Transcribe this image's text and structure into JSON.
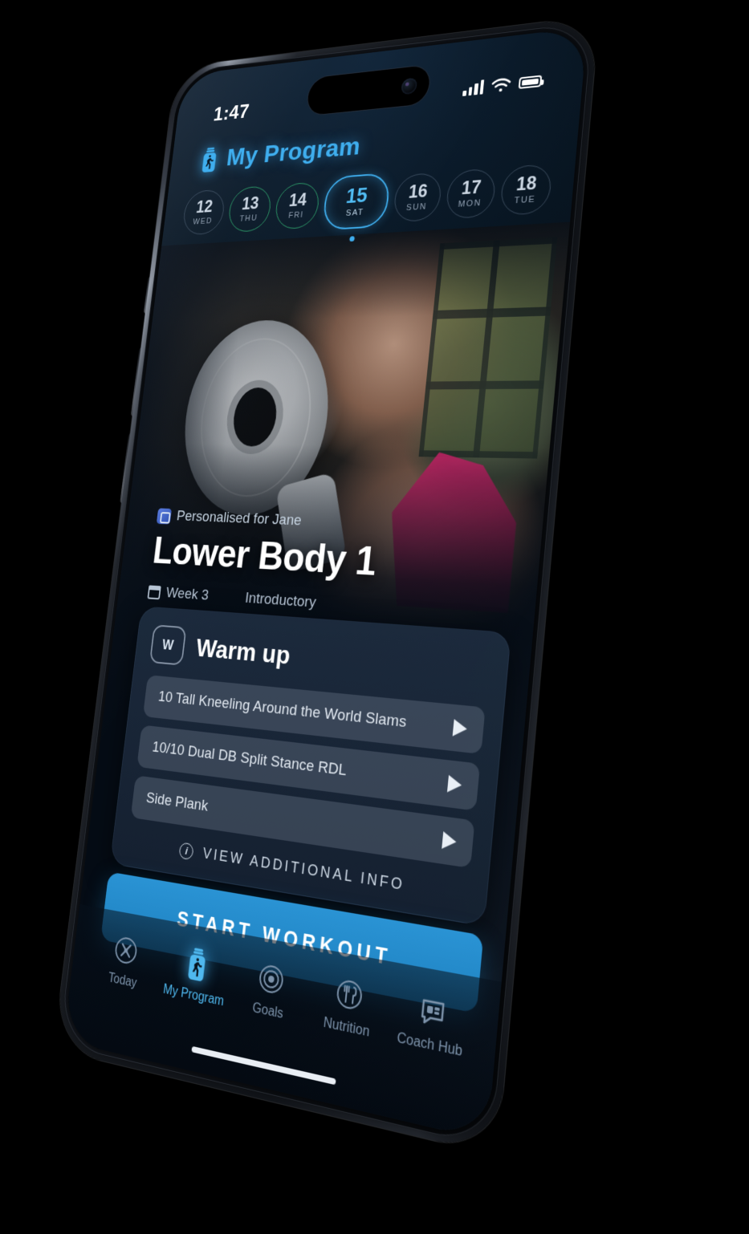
{
  "status_bar": {
    "time": "1:47",
    "icons": [
      "signal-bars-icon",
      "wifi-icon",
      "battery-icon"
    ]
  },
  "header": {
    "title": "My Program",
    "icon": "program-bottle-icon",
    "accent_color": "#3FAEEE"
  },
  "date_strip": {
    "days": [
      {
        "num": "12",
        "weekday": "WED",
        "state": "past"
      },
      {
        "num": "13",
        "weekday": "THU",
        "state": "completed"
      },
      {
        "num": "14",
        "weekday": "FRI",
        "state": "completed"
      },
      {
        "num": "15",
        "weekday": "SAT",
        "state": "selected"
      },
      {
        "num": "16",
        "weekday": "SUN",
        "state": "future"
      },
      {
        "num": "17",
        "weekday": "MON",
        "state": "future"
      },
      {
        "num": "18",
        "weekday": "TUE",
        "state": "future"
      }
    ],
    "completed_color": "#2E9E6B",
    "selected_color": "#3FAEEE"
  },
  "workout": {
    "personalised_label": "Personalised for Jane",
    "personalised_icon": "personalised-badge-icon",
    "title": "Lower Body 1",
    "week_label": "Week 3",
    "week_icon": "calendar-icon",
    "level_label": "Introductory"
  },
  "warmup_card": {
    "badge": "W",
    "title": "Warm up",
    "exercises": [
      {
        "name": "10 Tall Kneeling Around the World Slams"
      },
      {
        "name": "10/10 Dual DB Split Stance RDL"
      },
      {
        "name": "Side Plank"
      }
    ],
    "info_link": "VIEW ADDITIONAL INFO",
    "info_icon": "info-circle-icon"
  },
  "primary_action": {
    "label": "START WORKOUT",
    "color": "#2A93D4"
  },
  "tab_bar": {
    "items": [
      {
        "label": "Today",
        "icon": "today-icon",
        "active": false
      },
      {
        "label": "My Program",
        "icon": "program-bottle-icon",
        "active": true
      },
      {
        "label": "Goals",
        "icon": "target-icon",
        "active": false
      },
      {
        "label": "Nutrition",
        "icon": "cutlery-icon",
        "active": false
      },
      {
        "label": "Coach Hub",
        "icon": "chat-coach-icon",
        "active": false
      }
    ],
    "active_color": "#4FB8EF",
    "inactive_color": "#7d93ab"
  }
}
